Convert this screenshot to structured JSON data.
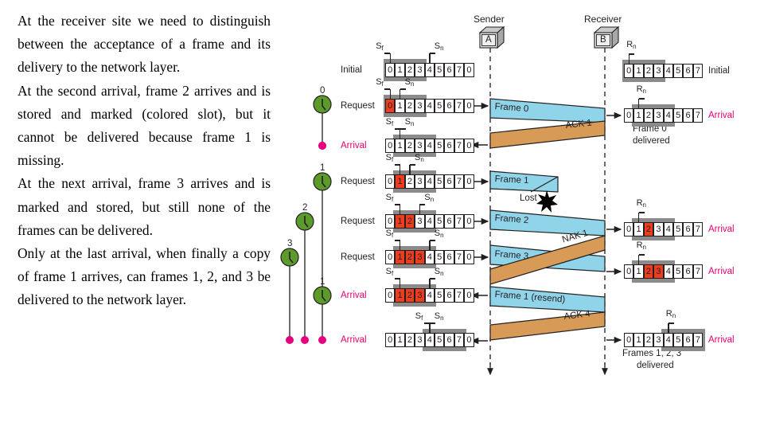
{
  "prose": {
    "paragraphs": [
      "At the receiver site we need to distinguish between the acceptance of a frame and its delivery to the network layer.",
      "At the second arrival, frame 2 arrives and is stored and marked (colored slot), but it cannot be delivered because frame 1 is missing.",
      "At the next arrival, frame 3 arrives and is marked and stored, but still none of the frames can be delivered.",
      "Only at the last arrival, when finally a copy of frame 1 arrives, can frames 1, 2, and 3 be delivered to the network layer."
    ]
  },
  "diagram": {
    "sender": {
      "title": "Sender",
      "node": "A"
    },
    "receiver": {
      "title": "Receiver",
      "node": "B"
    },
    "colors": {
      "frame": "#8fd4e8",
      "ack": "#d79a57",
      "window": "#8b8b8b",
      "marked_slot": "#ee3d1e",
      "timer": "#5c9a2c",
      "event_dot": "#e6007e",
      "arrival_label": "#e6006e",
      "line": "#231f20"
    },
    "sender_rows": [
      {
        "event": "Initial",
        "event_type": "initial",
        "sf_label": "S",
        "sf_sub": "f",
        "sn_label": "S",
        "sn_sub": "n",
        "cells": [
          "0",
          "1",
          "2",
          "3",
          "4",
          "5",
          "6",
          "7",
          "0"
        ],
        "marked": [],
        "window_start": 0,
        "window_end": 3,
        "sf_index": 0,
        "sn_index": 4
      },
      {
        "event": "Request",
        "event_type": "request",
        "sf_label": "S",
        "sf_sub": "f",
        "sn_label": "S",
        "sn_sub": "n",
        "cells": [
          "0",
          "1",
          "2",
          "3",
          "4",
          "5",
          "6",
          "7",
          "0"
        ],
        "marked": [
          0
        ],
        "window_start": 0,
        "window_end": 3,
        "sf_index": 0,
        "sn_index": 1
      },
      {
        "event": "Arrival",
        "event_type": "arrival",
        "sf_label": "S",
        "sf_sub": "f",
        "sn_label": "S",
        "sn_sub": "n",
        "cells": [
          "0",
          "1",
          "2",
          "3",
          "4",
          "5",
          "6",
          "7",
          "0"
        ],
        "marked": [],
        "window_start": 1,
        "window_end": 4,
        "sf_index": 1,
        "sn_index": 1
      },
      {
        "event": "Request",
        "event_type": "request",
        "sf_label": "S",
        "sf_sub": "f",
        "sn_label": "S",
        "sn_sub": "n",
        "cells": [
          "0",
          "1",
          "2",
          "3",
          "4",
          "5",
          "6",
          "7",
          "0"
        ],
        "marked": [
          1
        ],
        "window_start": 1,
        "window_end": 4,
        "sf_index": 1,
        "sn_index": 2
      },
      {
        "event": "Request",
        "event_type": "request",
        "sf_label": "S",
        "sf_sub": "f",
        "sn_label": "S",
        "sn_sub": "n",
        "cells": [
          "0",
          "1",
          "2",
          "3",
          "4",
          "5",
          "6",
          "7",
          "0"
        ],
        "marked": [
          1,
          2
        ],
        "window_start": 1,
        "window_end": 4,
        "sf_index": 1,
        "sn_index": 3
      },
      {
        "event": "Request",
        "event_type": "request",
        "sf_label": "S",
        "sf_sub": "f",
        "sn_label": "S",
        "sn_sub": "n",
        "cells": [
          "0",
          "1",
          "2",
          "3",
          "4",
          "5",
          "6",
          "7",
          "0"
        ],
        "marked": [
          1,
          2,
          3
        ],
        "window_start": 1,
        "window_end": 4,
        "sf_index": 1,
        "sn_index": 4
      },
      {
        "event": "Arrival",
        "event_type": "arrival",
        "sf_label": "S",
        "sf_sub": "f",
        "sn_label": "S",
        "sn_sub": "n",
        "cells": [
          "0",
          "1",
          "2",
          "3",
          "4",
          "5",
          "6",
          "7",
          "0"
        ],
        "marked": [
          1,
          2,
          3
        ],
        "window_start": 1,
        "window_end": 4,
        "sf_index": 1,
        "sn_index": 4
      },
      {
        "event": "Arrival",
        "event_type": "arrival",
        "sf_label": "S",
        "sf_sub": "f",
        "sn_label": "S",
        "sn_sub": "n",
        "cells": [
          "0",
          "1",
          "2",
          "3",
          "4",
          "5",
          "6",
          "7",
          "0"
        ],
        "marked": [],
        "window_start": 4,
        "window_end": 7,
        "sf_index": 4,
        "sn_index": 4
      }
    ],
    "receiver_rows": [
      {
        "event": "Initial",
        "rn_label": "R",
        "rn_sub": "n",
        "cells": [
          "0",
          "1",
          "2",
          "3",
          "4",
          "5",
          "6",
          "7"
        ],
        "marked": [],
        "window_start": 0,
        "window_end": 3,
        "rn_index": 0,
        "note": ""
      },
      {
        "event": "Arrival",
        "rn_label": "R",
        "rn_sub": "n",
        "cells": [
          "0",
          "1",
          "2",
          "3",
          "4",
          "5",
          "6",
          "7"
        ],
        "marked": [],
        "window_start": 1,
        "window_end": 4,
        "rn_index": 1,
        "note": "Frame 0\ndelivered"
      },
      {
        "event": "Arrival",
        "rn_label": "R",
        "rn_sub": "n",
        "cells": [
          "0",
          "1",
          "2",
          "3",
          "4",
          "5",
          "6",
          "7"
        ],
        "marked": [
          2
        ],
        "window_start": 1,
        "window_end": 4,
        "rn_index": 1,
        "note": ""
      },
      {
        "event": "Arrival",
        "rn_label": "R",
        "rn_sub": "n",
        "cells": [
          "0",
          "1",
          "2",
          "3",
          "4",
          "5",
          "6",
          "7"
        ],
        "marked": [
          2,
          3
        ],
        "window_start": 1,
        "window_end": 4,
        "rn_index": 1,
        "note": ""
      },
      {
        "event": "Arrival",
        "rn_label": "R",
        "rn_sub": "n",
        "cells": [
          "0",
          "1",
          "2",
          "3",
          "4",
          "5",
          "6",
          "7"
        ],
        "marked": [],
        "window_start": 4,
        "window_end": 7,
        "rn_index": 4,
        "note": "Frames 1, 2, 3\ndelivered"
      }
    ],
    "messages": [
      {
        "label": "Frame 0",
        "kind": "frame"
      },
      {
        "label": "ACK 1",
        "kind": "ack"
      },
      {
        "label": "Frame 1",
        "kind": "frame",
        "lost": true,
        "lost_label": "Lost"
      },
      {
        "label": "Frame 2",
        "kind": "frame"
      },
      {
        "label": "Frame 3",
        "kind": "frame"
      },
      {
        "label": "NAK 1",
        "kind": "ack"
      },
      {
        "label": "Frame 1 (resend)",
        "kind": "frame"
      },
      {
        "label": "ACK 4",
        "kind": "ack"
      }
    ],
    "timers": [
      {
        "id": "0",
        "label": "0"
      },
      {
        "id": "1",
        "label": "1"
      },
      {
        "id": "2",
        "label": "2"
      },
      {
        "id": "3",
        "label": "3"
      },
      {
        "id": "1b",
        "label": "1"
      }
    ],
    "receiver_notes": {
      "frame0_delivered_line1": "Frame 0",
      "frame0_delivered_line2": "delivered",
      "final_line1": "Frames 1, 2, 3",
      "final_line2": "delivered"
    }
  }
}
